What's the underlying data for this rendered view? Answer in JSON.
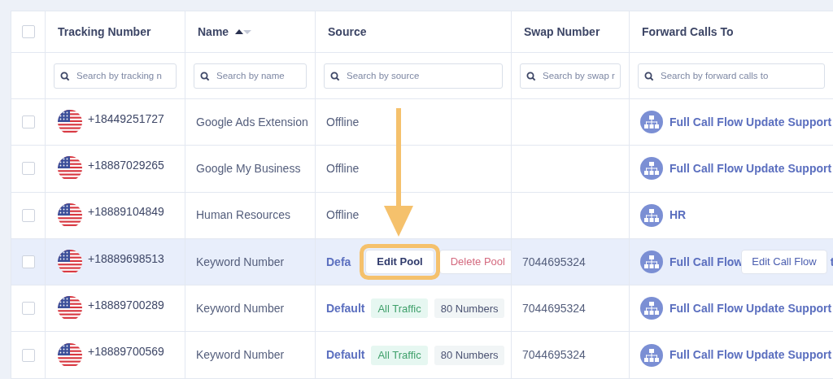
{
  "table": {
    "select_all": {
      "checked": false
    },
    "columns": [
      {
        "label": "Tracking Number",
        "placeholder": "Search by tracking n"
      },
      {
        "label": "Name",
        "placeholder": "Search by name",
        "sorted": true
      },
      {
        "label": "Source",
        "placeholder": "Search by source"
      },
      {
        "label": "Swap Number",
        "placeholder": "Search by swap r"
      },
      {
        "label": "Forward Calls To",
        "placeholder": "Search by forward calls to"
      }
    ],
    "rows": [
      {
        "checked": false,
        "hovered": false,
        "number": "+18449251727",
        "name": "Google Ads Extension",
        "source": {
          "kind": "plain",
          "label": "Offline"
        },
        "forward": {
          "label": "Full Call Flow Update Support"
        }
      },
      {
        "checked": false,
        "hovered": false,
        "number": "+18887029265",
        "name": "Google My Business",
        "source": {
          "kind": "plain",
          "label": "Offline"
        },
        "forward": {
          "label": "Full Call Flow Update Support"
        }
      },
      {
        "checked": false,
        "hovered": false,
        "number": "+18889104849",
        "name": "Human Resources",
        "source": {
          "kind": "plain",
          "label": "Offline"
        },
        "forward": {
          "label": "HR"
        }
      },
      {
        "checked": false,
        "hovered": true,
        "number": "+18889698513",
        "name": "Keyword Number",
        "source": {
          "kind": "pool",
          "label": "Defa",
          "actions": [
            {
              "label": "Edit Pool",
              "kind": "primary",
              "highlighted": true
            },
            {
              "label": "Delete Pool",
              "kind": "danger",
              "highlighted": false
            }
          ]
        },
        "swap": "7044695324",
        "forward": {
          "label": "Full Call Flow",
          "action": "Edit Call Flow",
          "tail": "t"
        }
      },
      {
        "checked": false,
        "hovered": false,
        "number": "+18889700289",
        "name": "Keyword Number",
        "source": {
          "kind": "pool",
          "label": "Default",
          "tags": [
            {
              "label": "All Traffic",
              "kind": "green"
            },
            {
              "label": "80 Numbers",
              "kind": "gray"
            }
          ]
        },
        "swap": "7044695324",
        "forward": {
          "label": "Full Call Flow Update Support"
        }
      },
      {
        "checked": false,
        "hovered": false,
        "number": "+18889700569",
        "name": "Keyword Number",
        "source": {
          "kind": "pool",
          "label": "Default",
          "tags": [
            {
              "label": "All Traffic",
              "kind": "green"
            },
            {
              "label": "80 Numbers",
              "kind": "gray"
            }
          ]
        },
        "swap": "7044695324",
        "forward": {
          "label": "Full Call Flow Update Support"
        }
      }
    ]
  }
}
